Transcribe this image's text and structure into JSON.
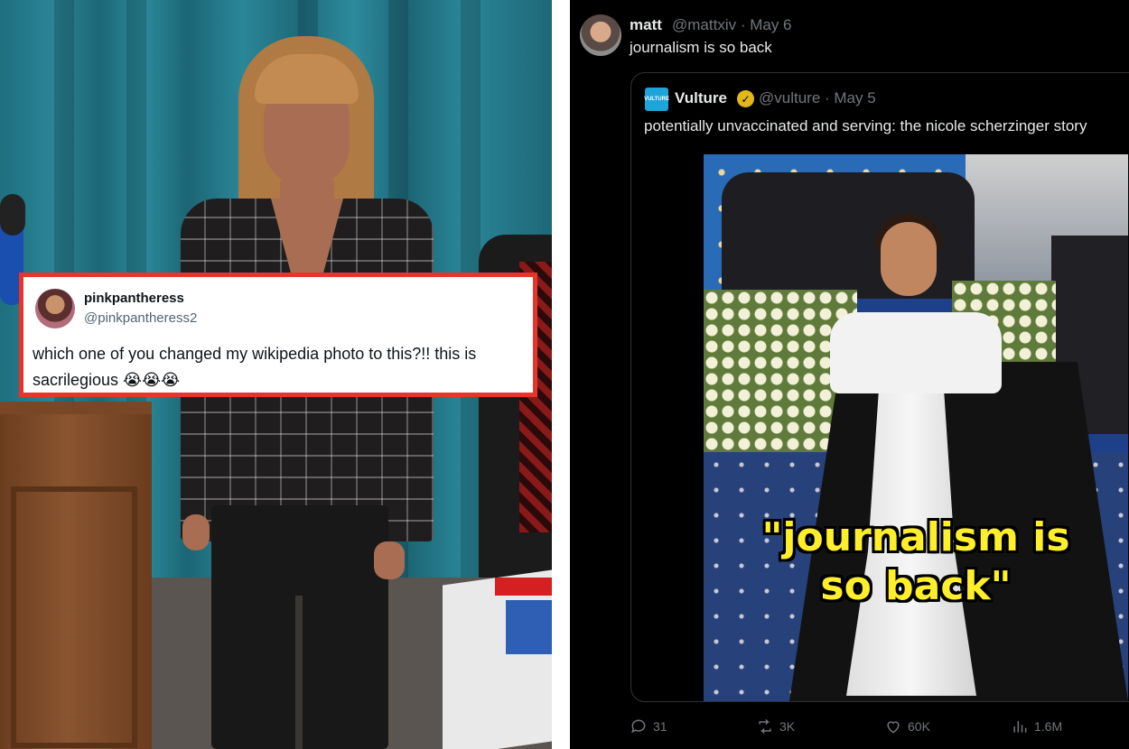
{
  "left_tweet": {
    "display_name": "pinkpantheress",
    "handle": "@pinkpantheress2",
    "text": "which one of you  changed my wikipedia photo to this?!! this is sacrilegious 😭😭😭"
  },
  "right_tweet": {
    "display_name": "matt",
    "meta": "@mattxiv · May 6",
    "text": "journalism is so back",
    "quoted": {
      "logo_text": "VULTURE",
      "display_name": "Vulture",
      "verified_icon": "verified-badge-icon",
      "meta": "@vulture · May 5",
      "text": "potentially unvaccinated and serving: the nicole scherzinger story",
      "image_caption": "\"journalism is so back\""
    },
    "actions": {
      "replies": "31",
      "reposts": "3K",
      "likes": "60K",
      "views": "1.6M"
    }
  },
  "colors": {
    "highlight_border": "#e8352a",
    "dark_background": "#000000",
    "muted_text": "#71767b",
    "caption_yellow": "#ffef2a",
    "verified_gold": "#e2b719"
  }
}
